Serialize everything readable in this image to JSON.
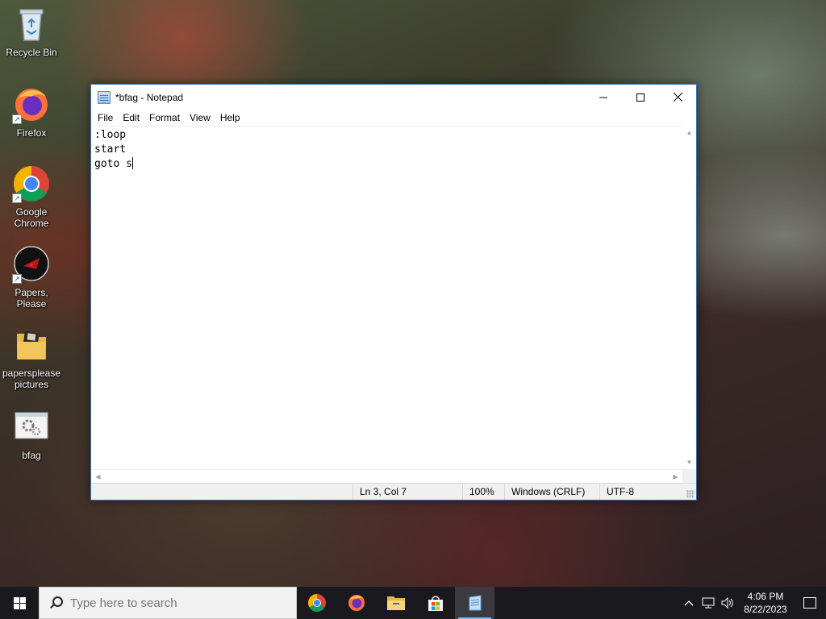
{
  "desktop": {
    "icons": [
      {
        "label": "Recycle Bin",
        "icon": "recycle-bin-icon"
      },
      {
        "label": "Firefox",
        "icon": "firefox-icon"
      },
      {
        "label": "Google Chrome",
        "icon": "chrome-icon"
      },
      {
        "label": "Papers, Please",
        "icon": "papers-please-icon"
      },
      {
        "label": "papersplease pictures",
        "icon": "folder-icon"
      },
      {
        "label": "bfag",
        "icon": "batch-file-icon"
      }
    ]
  },
  "notepad": {
    "title": "*bfag - Notepad",
    "menu": [
      "File",
      "Edit",
      "Format",
      "View",
      "Help"
    ],
    "lines": [
      ":loop",
      "start",
      "goto s"
    ],
    "status": {
      "position": "Ln 3, Col 7",
      "zoom": "100%",
      "line_ending": "Windows (CRLF)",
      "encoding": "UTF-8"
    }
  },
  "taskbar": {
    "search_placeholder": "Type here to search",
    "apps": [
      "chrome-icon",
      "firefox-icon",
      "file-explorer-icon",
      "store-icon",
      "notepad-icon"
    ],
    "active_app": "notepad-icon",
    "clock": {
      "time": "4:06 PM",
      "date": "8/22/2023"
    }
  },
  "colors": {
    "taskbar_bg": "#1a1a1e",
    "active_indicator": "#76b9ed",
    "statusbar_bg": "#f0f0f0"
  }
}
